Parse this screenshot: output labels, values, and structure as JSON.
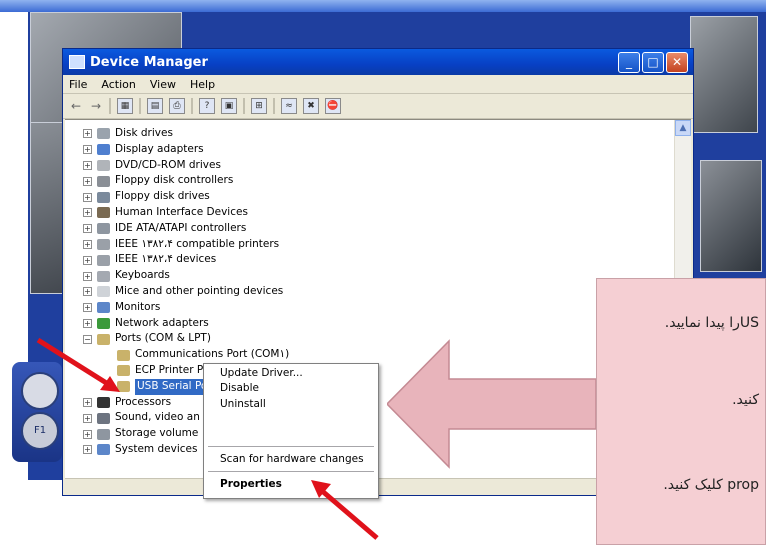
{
  "window": {
    "title": "Device Manager",
    "minimize_glyph": "_",
    "maximize_glyph": "□",
    "close_glyph": "✕"
  },
  "menu": [
    "File",
    "Action",
    "View",
    "Help"
  ],
  "dock": {
    "key_top": "",
    "key_bottom": "F1"
  },
  "toolbar_icons": [
    "back-arrow-icon",
    "forward-arrow-icon",
    "show-hide-console-tree-icon",
    "properties-icon",
    "print-icon",
    "help-icon",
    "driver-icon",
    "scan-hardware-icon",
    "update-driver-icon",
    "uninstall-icon",
    "disable-icon"
  ],
  "tree": [
    {
      "label": "Disk drives",
      "expander": "+",
      "color": "#9aa3ad"
    },
    {
      "label": "Display adapters",
      "expander": "+",
      "color": "#4f7fcf"
    },
    {
      "label": "DVD/CD-ROM drives",
      "expander": "+",
      "color": "#b0b4b9"
    },
    {
      "label": "Floppy disk controllers",
      "expander": "+",
      "color": "#8a8f96"
    },
    {
      "label": "Floppy disk drives",
      "expander": "+",
      "color": "#7b8a9c"
    },
    {
      "label": "Human Interface Devices",
      "expander": "+",
      "color": "#7a6a52"
    },
    {
      "label": "IDE ATA/ATAPI controllers",
      "expander": "+",
      "color": "#8e96a0"
    },
    {
      "label": "IEEE ١٣٨٢،۴ compatible printers",
      "expander": "+",
      "color": "#9aa0a8"
    },
    {
      "label": "IEEE ١٣٨٢،۴ devices",
      "expander": "+",
      "color": "#9aa0a8"
    },
    {
      "label": "Keyboards",
      "expander": "+",
      "color": "#a4a9b1"
    },
    {
      "label": "Mice and other pointing devices",
      "expander": "+",
      "color": "#cfd3d8"
    },
    {
      "label": "Monitors",
      "expander": "+",
      "color": "#5c86c9"
    },
    {
      "label": "Network adapters",
      "expander": "+",
      "color": "#3b9a3b"
    },
    {
      "label": "Ports (COM & LPT)",
      "expander": "−",
      "color": "#c9b26a"
    },
    {
      "label": "Communications Port (COM١)",
      "child": true,
      "color": "#c9b26a"
    },
    {
      "label": "ECP Printer Port (LPT١)",
      "child": true,
      "color": "#c9b26a"
    },
    {
      "label": "USB Serial Port (COM٧)",
      "child": true,
      "selected": true,
      "color": "#c9b26a"
    },
    {
      "label": "Processors",
      "expander": "+",
      "color": "#333333"
    },
    {
      "label": "Sound, video an",
      "expander": "+",
      "color": "#6d7480"
    },
    {
      "label": "Storage volume",
      "expander": "+",
      "color": "#8e96a0"
    },
    {
      "label": "System devices",
      "expander": "+",
      "color": "#5c86c9"
    }
  ],
  "context_menu": {
    "update_driver": "Update Driver...",
    "disable": "Disable",
    "uninstall": "Uninstall",
    "scan": "Scan for hardware changes",
    "properties": "Properties"
  },
  "note": {
    "line1": "USرا پیدا نمایید.",
    "line2": "کنید.",
    "line3": "prop کلیک کنید."
  },
  "colors": {
    "accent": "#316ac5",
    "note_bg": "#f5cfd3",
    "arrow_red": "#e0121b"
  }
}
